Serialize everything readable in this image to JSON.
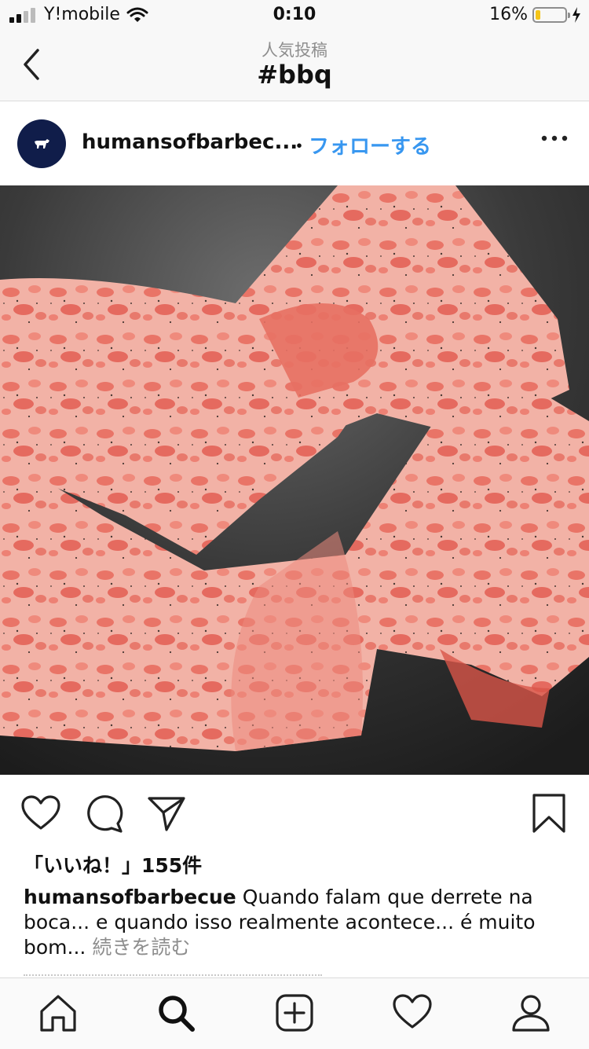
{
  "status_bar": {
    "carrier": "Y!mobile",
    "time": "0:10",
    "battery_percent": "16%",
    "battery_level": 0.16
  },
  "navbar": {
    "subtitle": "人気投稿",
    "title": "#bbq"
  },
  "post": {
    "username_truncated": "humansofbarbec...",
    "separator": "・",
    "follow_label": "フォローする",
    "likes": "「いいね！」155件",
    "caption_user": "humansofbarbecue",
    "caption_text": "Quando falam que derrete na boca... e quando isso realmente acontece... é muito bom...",
    "read_more": "続きを読む"
  },
  "colors": {
    "accent": "#3897f0",
    "avatar_bg": "#101d4a",
    "battery": "#f5c518"
  }
}
